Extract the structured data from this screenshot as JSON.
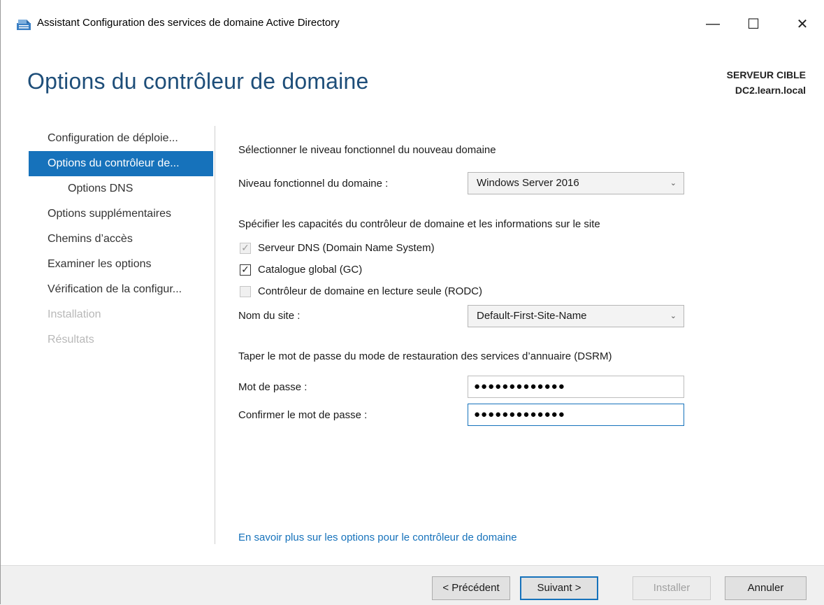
{
  "window": {
    "title": "Assistant Configuration des services de domaine Active Directory",
    "minimize_glyph": "—",
    "maximize_glyph": "☐",
    "close_glyph": "✕"
  },
  "header": {
    "page_title": "Options du contrôleur de domaine",
    "target_label": "SERVEUR CIBLE",
    "target_server": "DC2.learn.local"
  },
  "nav": {
    "items": [
      {
        "label": "Configuration de déploie...",
        "state": "normal"
      },
      {
        "label": "Options du contrôleur de...",
        "state": "active"
      },
      {
        "label": "Options DNS",
        "state": "sub"
      },
      {
        "label": "Options supplémentaires",
        "state": "normal"
      },
      {
        "label": "Chemins d’accès",
        "state": "normal"
      },
      {
        "label": "Examiner les options",
        "state": "normal"
      },
      {
        "label": "Vérification de la configur...",
        "state": "normal"
      },
      {
        "label": "Installation",
        "state": "disabled"
      },
      {
        "label": "Résultats",
        "state": "disabled"
      }
    ]
  },
  "content": {
    "functional_level_heading": "Sélectionner le niveau fonctionnel du nouveau domaine",
    "domain_level_label": "Niveau fonctionnel du domaine :",
    "domain_level_value": "Windows Server 2016",
    "capabilities_heading": "Spécifier les capacités du contrôleur de domaine et les informations sur le site",
    "dns_server_label": "Serveur DNS (Domain Name System)",
    "global_catalog_label": "Catalogue global (GC)",
    "rodc_label": "Contrôleur de domaine en lecture seule (RODC)",
    "check_glyph": "✓",
    "site_name_label": "Nom du site :",
    "site_name_value": "Default-First-Site-Name",
    "dsrm_heading": "Taper le mot de passe du mode de restauration des services d’annuaire (DSRM)",
    "password_label": "Mot de passe :",
    "password_value": "●●●●●●●●●●●●●",
    "confirm_label": "Confirmer le mot de passe :",
    "confirm_value": "●●●●●●●●●●●●●",
    "learn_more_link": "En savoir plus sur les options pour le contrôleur de domaine",
    "chevron_glyph": "⌄"
  },
  "footer": {
    "previous": "< Précédent",
    "next": "Suivant >",
    "install": "Installer",
    "cancel": "Annuler"
  },
  "colors": {
    "accent": "#1672bb",
    "title_blue": "#1e4e79"
  }
}
